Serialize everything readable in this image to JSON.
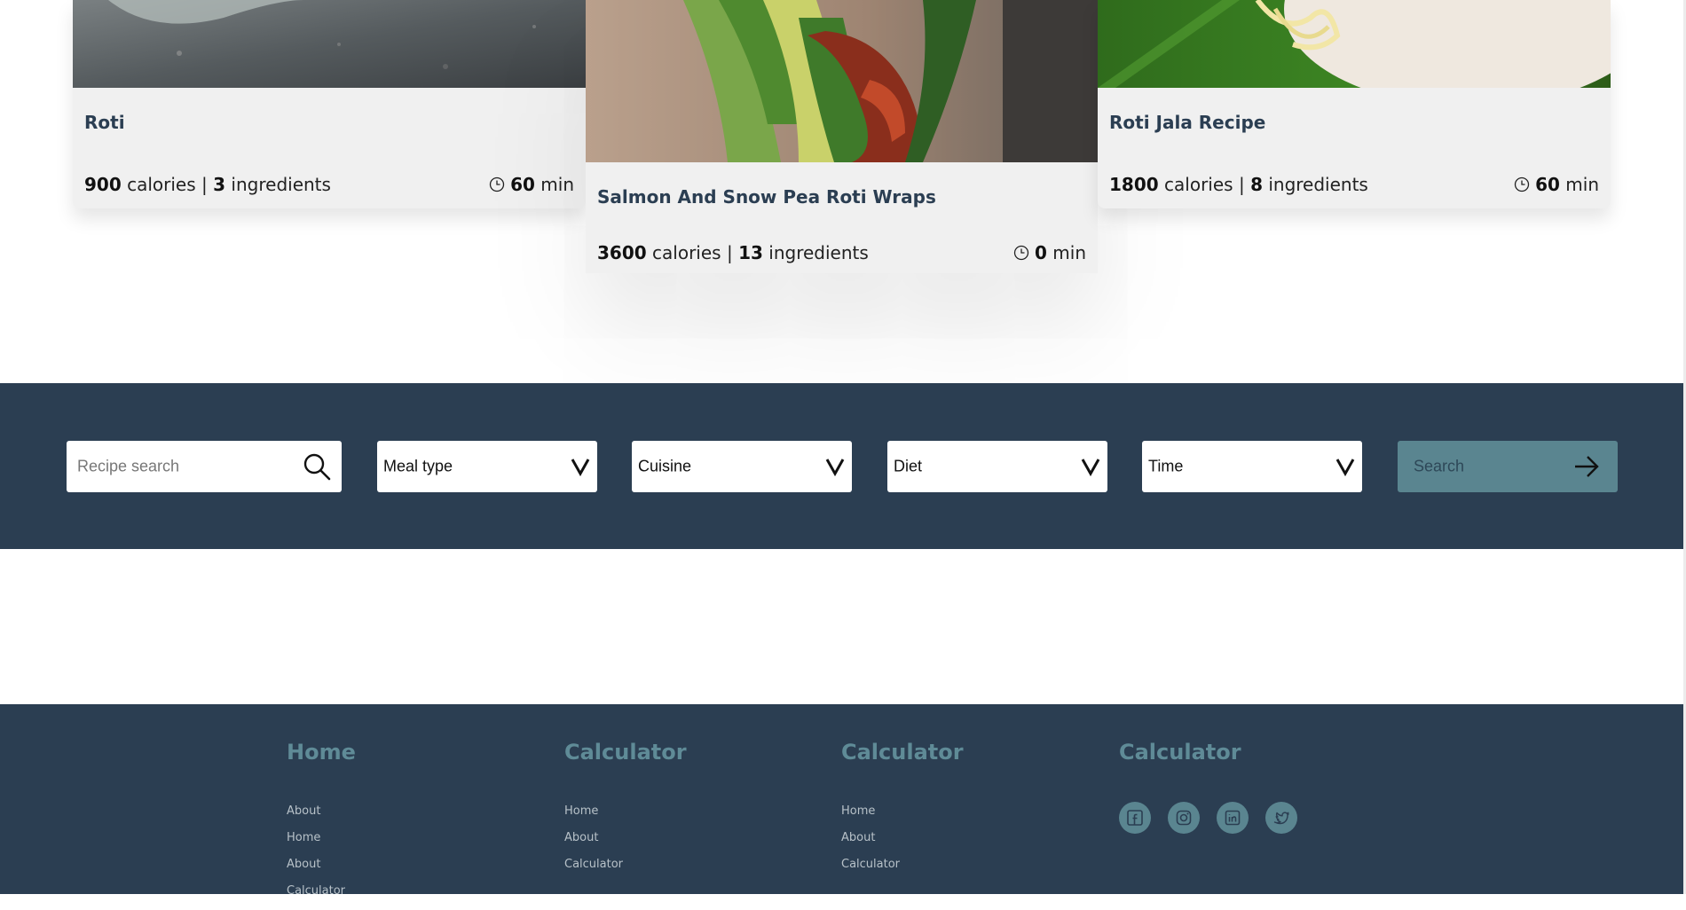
{
  "colors": {
    "navy": "#2b3e52",
    "teal": "#5a8590",
    "heading_teal": "#5f8b97",
    "card_bg": "#f0f0f0",
    "title_color": "#2b3e52"
  },
  "recipes": [
    {
      "title": "Roti",
      "calories": "900",
      "calories_label": "calories",
      "separator": "|",
      "ingredients": "3",
      "ingredients_label": "ingredients",
      "time": "60",
      "time_unit": "min",
      "time_icon": "clock-icon"
    },
    {
      "title": "Salmon And Snow Pea Roti Wraps",
      "calories": "3600",
      "calories_label": "calories",
      "separator": "|",
      "ingredients": "13",
      "ingredients_label": "ingredients",
      "time": "0",
      "time_unit": "min",
      "time_icon": "clock-icon"
    },
    {
      "title": "Roti Jala Recipe",
      "calories": "1800",
      "calories_label": "calories",
      "separator": "|",
      "ingredients": "8",
      "ingredients_label": "ingredients",
      "time": "60",
      "time_unit": "min",
      "time_icon": "clock-icon"
    }
  ],
  "search": {
    "placeholder": "Recipe search",
    "search_icon": "magnifier-icon",
    "dropdowns": [
      {
        "label": "Meal type",
        "icon": "chevron-down-icon"
      },
      {
        "label": "Cuisine",
        "icon": "chevron-down-icon"
      },
      {
        "label": "Diet",
        "icon": "chevron-down-icon"
      },
      {
        "label": "Time",
        "icon": "chevron-down-icon"
      }
    ],
    "submit_label": "Search",
    "submit_icon": "arrow-right-icon"
  },
  "footer": {
    "columns": [
      {
        "heading": "Home",
        "links": [
          "About",
          "Home",
          "About",
          "Calculator"
        ]
      },
      {
        "heading": "Calculator",
        "links": [
          "Home",
          "About",
          "Calculator"
        ]
      },
      {
        "heading": "Calculator",
        "links": [
          "Home",
          "About",
          "Calculator"
        ]
      }
    ],
    "social": {
      "heading": "Calculator",
      "icons": [
        "facebook-icon",
        "instagram-icon",
        "linkedin-icon",
        "twitter-icon"
      ]
    }
  }
}
